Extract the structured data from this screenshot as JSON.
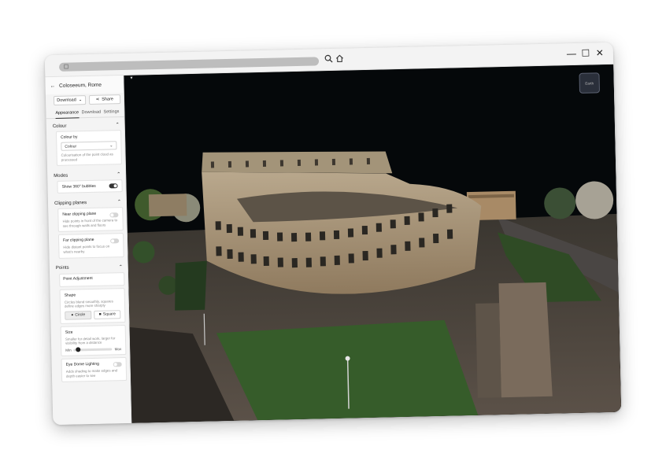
{
  "window": {
    "controls": {
      "minimize": "—",
      "maximize": "☐",
      "close": "✕"
    }
  },
  "sidebar": {
    "back_icon": "arrow-left-icon",
    "title": "Coloseeum, Rome",
    "download_label": "Download",
    "share_label": "Share",
    "tabs": [
      "Appearance",
      "Download",
      "Settings"
    ],
    "colour": {
      "section": "Colour",
      "colour_by_label": "Colour by",
      "selected": "Colour",
      "hint": "Colourisation of the point cloud as processed"
    },
    "modes": {
      "section": "Modes",
      "bubbles_label": "Show 360° bubbles",
      "bubbles_on": true
    },
    "clipping": {
      "section": "Clipping planes",
      "near_label": "Near clipping plane",
      "near_hint": "Hide points in front of the camera to see through walls and floors",
      "far_label": "Far clipping plane",
      "far_hint": "Hide distant points to focus on what's nearby"
    },
    "points": {
      "section": "Points",
      "adjustment_label": "Point Adjustment",
      "shape_label": "Shape",
      "shape_hint": "Circles blend smoothly, squares define edges more sharply",
      "circle_label": "Circle",
      "square_label": "Square",
      "size_label": "Size",
      "size_hint": "Smaller for detail work, larger for visibility from a distance",
      "min_label": "Min",
      "max_label": "Max",
      "size_value": 0.05,
      "edl_label": "Eye Dome Lighting",
      "edl_hint": "Adds shading to make edges and depth easier to see"
    }
  },
  "viewport": {
    "view_button_label": "Earth"
  }
}
